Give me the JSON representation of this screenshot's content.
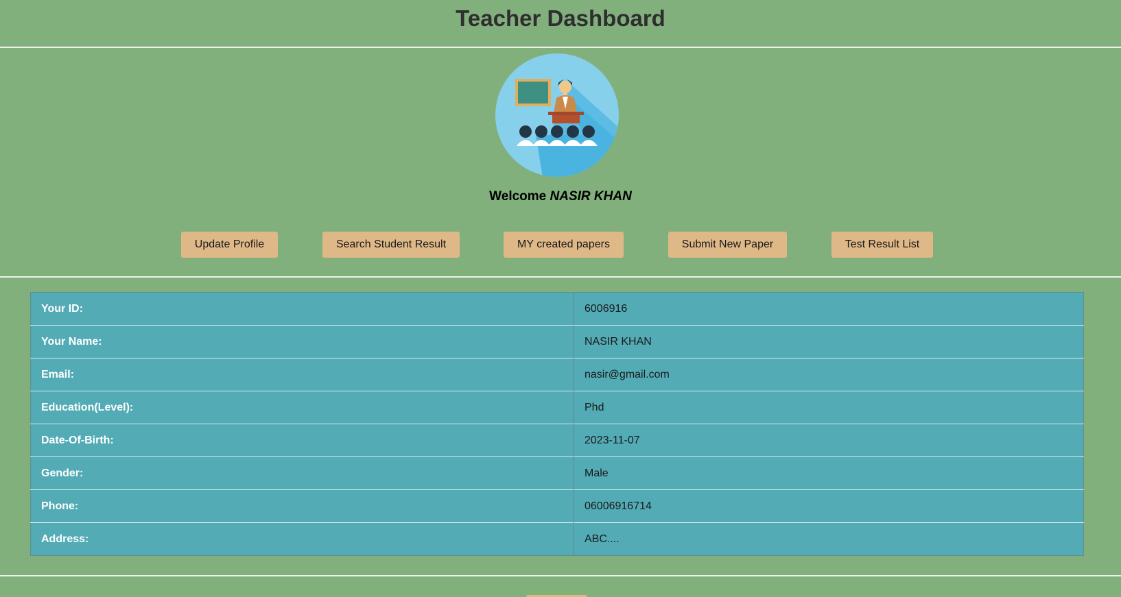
{
  "header": {
    "title": "Teacher Dashboard"
  },
  "welcome": {
    "prefix": "Welcome",
    "name": "NASIR KHAN"
  },
  "avatar": {
    "icon": "teacher-classroom-icon",
    "colors": {
      "circle": "#87d0ec",
      "shadow": "#4ab3e0",
      "board": "#3d9082",
      "board_frame": "#e3ae5b",
      "jacket": "#c98a4a",
      "desk": "#a5472b",
      "students": "#233645"
    }
  },
  "nav": {
    "buttons": [
      {
        "label": "Update Profile"
      },
      {
        "label": "Search Student Result"
      },
      {
        "label": "MY created papers"
      },
      {
        "label": "Submit New Paper"
      },
      {
        "label": "Test Result List"
      }
    ]
  },
  "profile": {
    "rows": [
      {
        "label": "Your ID:",
        "value": "6006916"
      },
      {
        "label": "Your Name:",
        "value": "NASIR KHAN"
      },
      {
        "label": "Email:",
        "value": "nasir@gmail.com"
      },
      {
        "label": "Education(Level):",
        "value": "Phd"
      },
      {
        "label": "Date-Of-Birth:",
        "value": "2023-11-07"
      },
      {
        "label": "Gender:",
        "value": "Male"
      },
      {
        "label": "Phone:",
        "value": "06006916714"
      },
      {
        "label": "Address:",
        "value": "ABC...."
      }
    ]
  },
  "theme": {
    "background": "#82b07d",
    "button": "#dfb887",
    "table": "#53abb5"
  }
}
